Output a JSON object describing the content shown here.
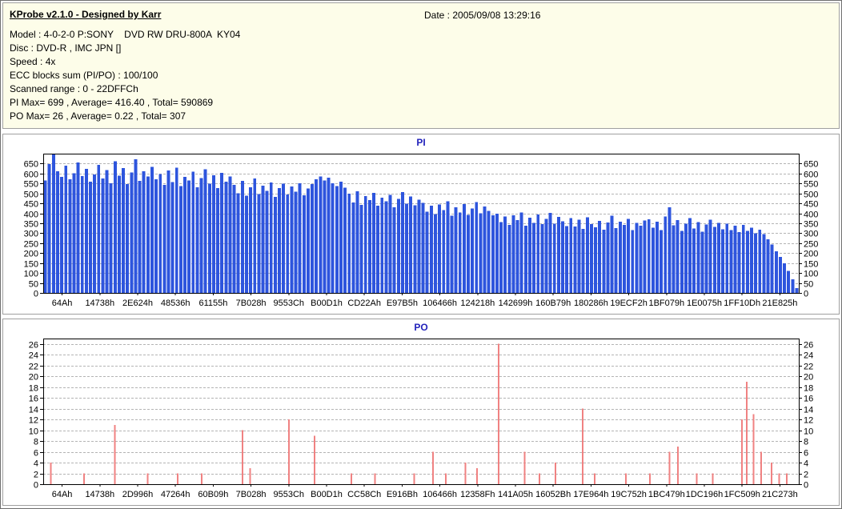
{
  "header": {
    "app_title": "KProbe v2.1.0 - Designed by Karr",
    "date_label": "Date : 2005/09/08 13:29:16",
    "info_lines": [
      "Model : 4-0-2-0 P:SONY    DVD RW DRU-800A  KY04",
      "Disc : DVD-R , IMC JPN []",
      "Speed : 4x",
      "ECC blocks sum (PI/PO) : 100/100",
      "Scanned range : 0 - 22DFFCh",
      "PI Max= 699 , Average= 416.40 , Total= 590869",
      "PO Max= 26 , Average= 0.22 , Total= 307"
    ]
  },
  "chart_data": [
    {
      "type": "bar",
      "title": "PI",
      "color": "#2e55dd",
      "grid": true,
      "legend": "none",
      "ylim": [
        0,
        700
      ],
      "ytick_step": 50,
      "ytick_max": 650,
      "x_labels": [
        "64Ah",
        "14738h",
        "2E624h",
        "48536h",
        "61155h",
        "7B028h",
        "9553Ch",
        "B00D1h",
        "CD22Ah",
        "E97B5h",
        "106466h",
        "124218h",
        "142699h",
        "160B79h",
        "180286h",
        "19ECF2h",
        "1BF079h",
        "1E0075h",
        "1FF10Dh",
        "21E825h"
      ],
      "values": [
        566,
        648,
        699,
        612,
        583,
        640,
        571,
        602,
        655,
        588,
        623,
        560,
        596,
        644,
        575,
        618,
        552,
        661,
        590,
        628,
        548,
        605,
        672,
        563,
        611,
        585,
        634,
        572,
        598,
        543,
        615,
        557,
        630,
        538,
        584,
        566,
        609,
        531,
        577,
        622,
        549,
        591,
        528,
        604,
        560,
        586,
        544,
        501,
        563,
        488,
        532,
        575,
        496,
        540,
        512,
        556,
        483,
        527,
        549,
        495,
        536,
        508,
        552,
        490,
        525,
        548,
        572,
        585,
        566,
        579,
        551,
        538,
        560,
        530,
        498,
        455,
        510,
        443,
        487,
        466,
        502,
        438,
        479,
        460,
        493,
        431,
        472,
        506,
        449,
        484,
        441,
        468,
        452,
        409,
        438,
        396,
        444,
        417,
        461,
        388,
        430,
        405,
        447,
        392,
        424,
        456,
        401,
        435,
        412,
        390,
        398,
        356,
        385,
        342,
        391,
        367,
        404,
        338,
        379,
        352,
        395,
        346,
        372,
        402,
        349,
        383,
        360,
        336,
        376,
        334,
        368,
        322,
        381,
        347,
        329,
        362,
        318,
        355,
        388,
        326,
        359,
        341,
        373,
        315,
        352,
        337,
        364,
        371,
        328,
        358,
        316,
        384,
        430,
        339,
        366,
        312,
        349,
        377,
        324,
        356,
        308,
        344,
        369,
        331,
        352,
        320,
        348,
        315,
        338,
        305,
        342,
        312,
        327,
        300,
        318,
        296,
        270,
        243,
        210,
        182,
        148,
        110,
        68,
        24
      ]
    },
    {
      "type": "bar",
      "title": "PO",
      "color": "#f08282",
      "grid": true,
      "legend": "none",
      "ylim": [
        0,
        27
      ],
      "ytick_step": 2,
      "ytick_max": 26,
      "x_labels": [
        "64Ah",
        "14738h",
        "2D996h",
        "47264h",
        "60B09h",
        "7B028h",
        "9553Ch",
        "B00D1h",
        "CC58Ch",
        "E916Bh",
        "106466h",
        "12358Fh",
        "141A05h",
        "16052Bh",
        "17E964h",
        "19C752h",
        "1BC479h",
        "1DC196h",
        "1FC509h",
        "21C273h"
      ],
      "spikes": [
        {
          "x": 0.01,
          "v": 4
        },
        {
          "x": 0.054,
          "v": 2
        },
        {
          "x": 0.095,
          "v": 11
        },
        {
          "x": 0.138,
          "v": 2
        },
        {
          "x": 0.178,
          "v": 2
        },
        {
          "x": 0.21,
          "v": 2
        },
        {
          "x": 0.264,
          "v": 10
        },
        {
          "x": 0.274,
          "v": 3
        },
        {
          "x": 0.325,
          "v": 12
        },
        {
          "x": 0.359,
          "v": 9
        },
        {
          "x": 0.408,
          "v": 2
        },
        {
          "x": 0.439,
          "v": 2
        },
        {
          "x": 0.491,
          "v": 2
        },
        {
          "x": 0.516,
          "v": 6
        },
        {
          "x": 0.533,
          "v": 2
        },
        {
          "x": 0.559,
          "v": 4
        },
        {
          "x": 0.574,
          "v": 3
        },
        {
          "x": 0.603,
          "v": 26
        },
        {
          "x": 0.637,
          "v": 6
        },
        {
          "x": 0.657,
          "v": 2
        },
        {
          "x": 0.678,
          "v": 4
        },
        {
          "x": 0.714,
          "v": 14
        },
        {
          "x": 0.73,
          "v": 2
        },
        {
          "x": 0.771,
          "v": 2
        },
        {
          "x": 0.803,
          "v": 2
        },
        {
          "x": 0.829,
          "v": 6
        },
        {
          "x": 0.84,
          "v": 7
        },
        {
          "x": 0.865,
          "v": 2
        },
        {
          "x": 0.886,
          "v": 2
        },
        {
          "x": 0.925,
          "v": 12
        },
        {
          "x": 0.931,
          "v": 19
        },
        {
          "x": 0.94,
          "v": 13
        },
        {
          "x": 0.95,
          "v": 6
        },
        {
          "x": 0.964,
          "v": 4
        },
        {
          "x": 0.974,
          "v": 2
        },
        {
          "x": 0.984,
          "v": 2
        }
      ]
    }
  ]
}
